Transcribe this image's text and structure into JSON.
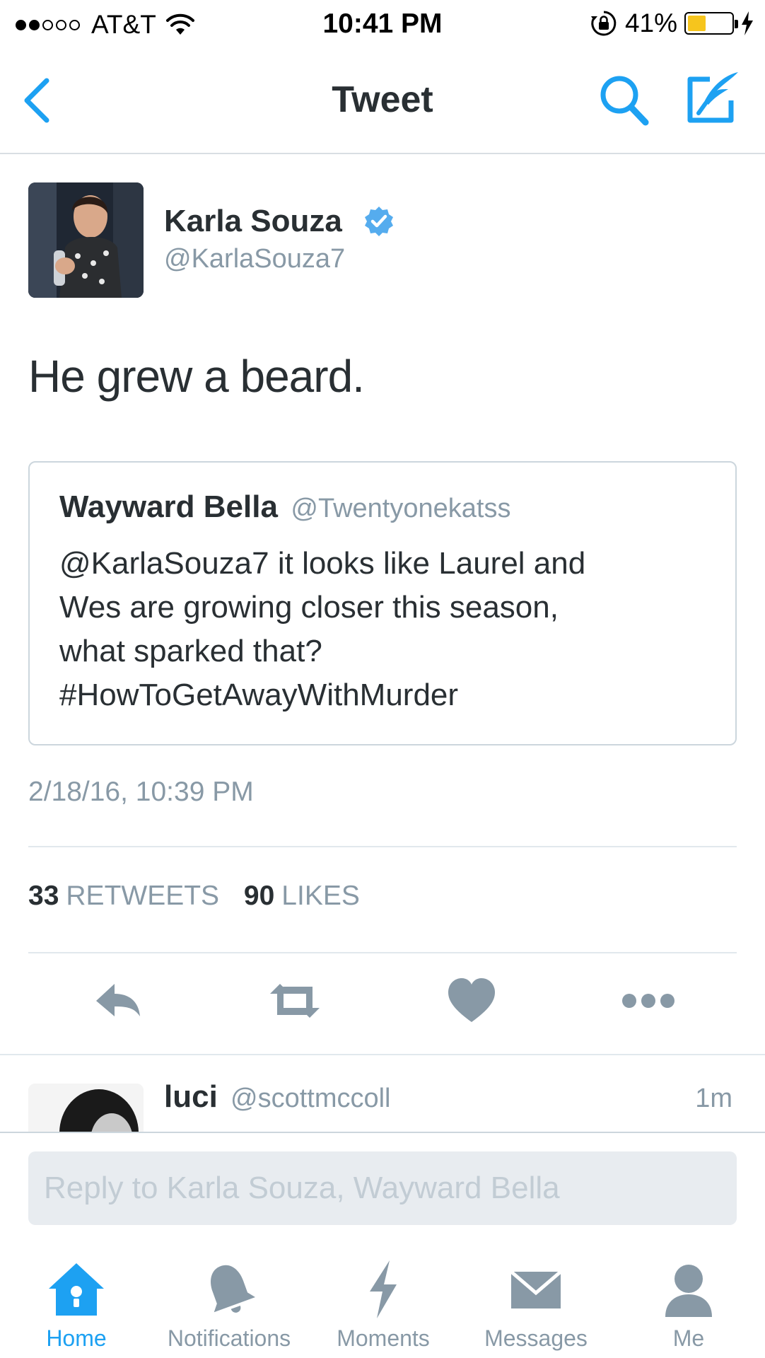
{
  "status_bar": {
    "carrier": "AT&T",
    "time": "10:41 PM",
    "battery_percent": "41%",
    "battery_level": 0.41,
    "signal_bars_filled": 2,
    "signal_bars_total": 5
  },
  "nav": {
    "title": "Tweet",
    "back_icon": "chevron-left-icon",
    "search_icon": "search-icon",
    "compose_icon": "compose-icon"
  },
  "tweet": {
    "author_name": "Karla Souza",
    "author_handle": "@KarlaSouza7",
    "verified": true,
    "text": "He grew a beard.",
    "quoted": {
      "name": "Wayward Bella",
      "handle": "@Twentyonekatss",
      "lines": [
        "@KarlaSouza7 it looks like Laurel and",
        "Wes are growing closer this season,",
        "what sparked that?",
        "#HowToGetAwayWithMurder"
      ]
    },
    "timestamp": "2/18/16, 10:39 PM",
    "retweets_count": "33",
    "retweets_label": "RETWEETS",
    "likes_count": "90",
    "likes_label": "LIKES"
  },
  "actions": [
    "reply-icon",
    "retweet-icon",
    "like-icon",
    "more-icon"
  ],
  "reply_preview": {
    "name": "luci",
    "handle": "@scottmccoll",
    "time": "1m"
  },
  "composer": {
    "placeholder": "Reply to Karla Souza, Wayward Bella"
  },
  "tabs": [
    {
      "label": "Home",
      "icon": "home-icon",
      "active": true
    },
    {
      "label": "Notifications",
      "icon": "bell-icon",
      "active": false
    },
    {
      "label": "Moments",
      "icon": "lightning-icon",
      "active": false
    },
    {
      "label": "Messages",
      "icon": "envelope-icon",
      "active": false
    },
    {
      "label": "Me",
      "icon": "person-icon",
      "active": false
    }
  ],
  "colors": {
    "accent": "#1da1f2",
    "text": "#292f33",
    "muted": "#8899a6",
    "battery": "#f6c51d"
  }
}
